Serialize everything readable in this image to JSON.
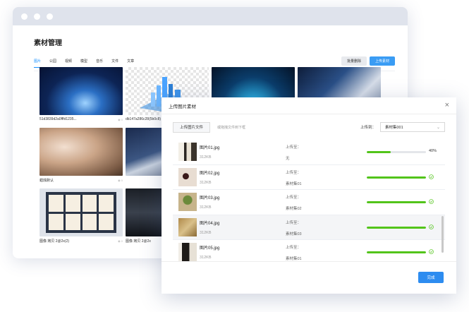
{
  "page": {
    "title": "素材管理",
    "tabs": [
      "图片",
      "公园",
      "视频",
      "模型",
      "音乐",
      "文件",
      "文章"
    ],
    "buttons": {
      "batch_delete": "批量删除",
      "upload": "上传素材"
    }
  },
  "cards": [
    {
      "caption": "51d3839d2a0fffd1235...",
      "views": "0"
    },
    {
      "caption": "db147a286c28(5b0c8)"
    },
    {
      "caption": ""
    },
    {
      "caption": ""
    },
    {
      "caption": "蜡烛默认",
      "views": "0"
    },
    {
      "caption": ""
    },
    {
      "caption": "图像 拷贝 2@2x(2)",
      "views": "0"
    },
    {
      "caption": "图像 拷贝 2@2x",
      "views": "0"
    }
  ],
  "modal": {
    "title": "上传图片素材",
    "upload_button": "上传图片文件",
    "drag_hint": "或拖拽文件到下框",
    "upload_to_label": "上传到：",
    "upload_to_value": "素材集001",
    "done_button": "完成",
    "files": [
      {
        "name": "图片01.jpg",
        "size": "312KB",
        "dest_label": "上传至：",
        "dest": "无",
        "progress": 0.4,
        "progress_text": "40%"
      },
      {
        "name": "图片02.jpg",
        "size": "312KB",
        "dest_label": "上传至：",
        "dest": "素材集01",
        "progress": 1.0,
        "status": "done"
      },
      {
        "name": "图片03.jpg",
        "size": "312KB",
        "dest_label": "上传至：",
        "dest": "素材集02",
        "progress": 1.0,
        "status": "done"
      },
      {
        "name": "图片04.jpg",
        "size": "312KB",
        "dest_label": "上传至：",
        "dest": "素材集03",
        "progress": 1.0,
        "status": "done"
      },
      {
        "name": "图片05.jpg",
        "size": "312KB",
        "dest_label": "上传至：",
        "dest": "素材集01",
        "progress": 1.0,
        "status": "done"
      }
    ]
  },
  "colors": {
    "accent": "#3a9cf4",
    "success": "#52c41a",
    "window_bar": "#dfe3ec"
  }
}
